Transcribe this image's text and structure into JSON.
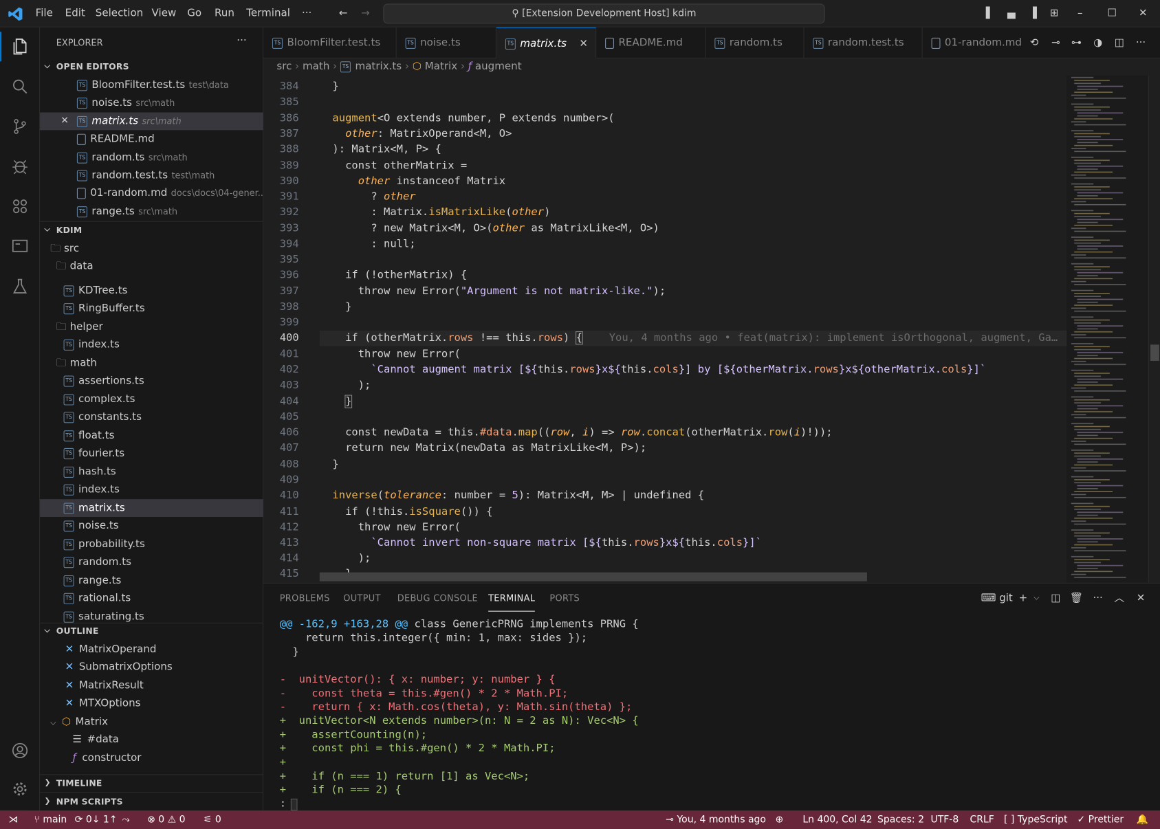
{
  "titlebar": {
    "menus": [
      "File",
      "Edit",
      "Selection",
      "View",
      "Go",
      "Run",
      "Terminal",
      "···"
    ],
    "command_center": "[Extension Development Host] kdim"
  },
  "sidebar": {
    "title": "EXPLORER",
    "open_editors_header": "OPEN EDITORS",
    "open_editors": [
      {
        "name": "BloomFilter.test.ts",
        "path": "test\\data",
        "icon": "ts"
      },
      {
        "name": "noise.ts",
        "path": "src\\math",
        "icon": "ts"
      },
      {
        "name": "matrix.ts",
        "path": "src\\math",
        "icon": "ts"
      },
      {
        "name": "README.md",
        "path": "",
        "icon": "md"
      },
      {
        "name": "random.ts",
        "path": "src\\math",
        "icon": "ts"
      },
      {
        "name": "random.test.ts",
        "path": "test\\math",
        "icon": "ts"
      },
      {
        "name": "01-random.md",
        "path": "docs\\docs\\04-gener...",
        "icon": "md"
      },
      {
        "name": "range.ts",
        "path": "src\\math",
        "icon": "ts"
      }
    ],
    "workspace_header": "KDIM",
    "folders": {
      "src": "src",
      "data": "data",
      "helper": "helper",
      "math": "math"
    },
    "data_files": [
      "KDTree.ts",
      "RingBuffer.ts"
    ],
    "helper_files": [
      "index.ts"
    ],
    "math_files": [
      "assertions.ts",
      "complex.ts",
      "constants.ts",
      "float.ts",
      "fourier.ts",
      "hash.ts",
      "index.ts",
      "matrix.ts",
      "noise.ts",
      "probability.ts",
      "random.ts",
      "range.ts",
      "rational.ts",
      "saturating.ts"
    ],
    "outline_header": "OUTLINE",
    "outline": {
      "types": [
        "MatrixOperand",
        "SubmatrixOptions",
        "MatrixResult",
        "MTXOptions"
      ],
      "class": "Matrix",
      "members": [
        "#data",
        "constructor"
      ]
    },
    "timeline_header": "TIMELINE",
    "npm_header": "NPM SCRIPTS"
  },
  "tabs": [
    "BloomFilter.test.ts",
    "noise.ts",
    "matrix.ts",
    "README.md",
    "random.ts",
    "random.test.ts",
    "01-random.md"
  ],
  "breadcrumb": {
    "src": "src",
    "math": "math",
    "file": "matrix.ts",
    "class": "Matrix",
    "method": "augment"
  },
  "editor": {
    "line_numbers": [
      "384",
      "385",
      "386",
      "387",
      "388",
      "389",
      "390",
      "391",
      "392",
      "393",
      "394",
      "395",
      "396",
      "397",
      "398",
      "399",
      "400",
      "401",
      "402",
      "403",
      "404",
      "405",
      "406",
      "407",
      "408",
      "409",
      "410",
      "411",
      "412",
      "413",
      "414",
      "415"
    ],
    "blame": "You, 4 months ago • feat(matrix): implement isOrthogonal, augment, Ga…",
    "code": {
      "l384_brace": "}",
      "l386_name": "augment",
      "l386_generics": "<O extends number, P extends number>(",
      "l387_param": "other",
      "l387_type": ": MatrixOperand<M, O>",
      "l388": "): Matrix<M, P> {",
      "l389": "const otherMatrix =",
      "l390_param": "other",
      "l390_rest": " instanceof Matrix",
      "l391_q": "? ",
      "l391_param": "other",
      "l392_a": ": Matrix.",
      "l392_fn": "isMatrixLike",
      "l392_param": "other",
      "l393_a": "? new Matrix<M, O>(",
      "l393_param": "other",
      "l393_b": " as MatrixLike<M, O>)",
      "l394": ": null;",
      "l396": "if (!otherMatrix) {",
      "l397_a": "throw new Error(",
      "l397_str": "\"Argument is not matrix-like.\"",
      "l397_b": ");",
      "l398": "}",
      "l400_a": "if (otherMatrix.",
      "l400_p1": "rows",
      "l400_b": " !== this.",
      "l400_p2": "rows",
      "l400_c": ") ",
      "l400_brace": "{",
      "l401": "throw new Error(",
      "l402_a": "`Cannot augment matrix [${",
      "l402_b": "this.",
      "l402_p1": "rows",
      "l402_c": "}x${",
      "l402_d": "this.",
      "l402_p2": "cols",
      "l402_e": "}] by [${otherMatrix.",
      "l402_p3": "rows",
      "l402_f": "}x${otherMatrix.",
      "l402_p4": "cols",
      "l402_g": "}]`",
      "l403": ");",
      "l404_brace": "}",
      "l406_a": "const newData = this.",
      "l406_p": "#data",
      "l406_b": ".",
      "l406_fn1": "map",
      "l406_c": "((",
      "l406_pm1": "row",
      "l406_d": ", ",
      "l406_pm2": "i",
      "l406_e": ") => ",
      "l406_pm3": "row",
      "l406_f": ".",
      "l406_fn2": "concat",
      "l406_g": "(otherMatrix.",
      "l406_fn3": "row",
      "l406_h": "(",
      "l406_pm4": "i",
      "l406_i": ")!));",
      "l407": "return new Matrix(newData as MatrixLike<M, P>);",
      "l408": "}",
      "l410_name": "inverse",
      "l410_a": "(",
      "l410_pm": "tolerance",
      "l410_b": ": number = ",
      "l410_num": "5",
      "l410_c": "): Matrix<M, M> | undefined {",
      "l411_a": "if (!this.",
      "l411_fn": "isSquare",
      "l411_b": "()) {",
      "l412": "throw new Error(",
      "l413_a": "`Cannot invert non-square matrix [${",
      "l413_b": "this.",
      "l413_p1": "rows",
      "l413_c": "}x${",
      "l413_d": "this.",
      "l413_p2": "cols",
      "l413_e": "}]`",
      "l414": ");",
      "l415": "}"
    }
  },
  "panel": {
    "tabs": [
      "PROBLEMS",
      "OUTPUT",
      "DEBUG CONSOLE",
      "TERMINAL",
      "PORTS"
    ],
    "shell_label": "git",
    "terminal_lines": [
      {
        "kind": "hunk",
        "a": "@@ -162,9 +163,28 @@",
        "b": " class GenericPRNG implements PRNG {"
      },
      {
        "kind": "ctx",
        "text": "    return this.integer({ min: 1, max: sides });"
      },
      {
        "kind": "ctx",
        "text": "  }"
      },
      {
        "kind": "ctx",
        "text": ""
      },
      {
        "kind": "del",
        "text": "-  unitVector(): { x: number; y: number } {"
      },
      {
        "kind": "del",
        "text": "-    const theta = this.#gen() * 2 * Math.PI;"
      },
      {
        "kind": "del",
        "text": "-    return { x: Math.cos(theta), y: Math.sin(theta) };"
      },
      {
        "kind": "add",
        "text": "+  unitVector<N extends number>(n: N = 2 as N): Vec<N> {"
      },
      {
        "kind": "add",
        "text": "+    assertCounting(n);"
      },
      {
        "kind": "add",
        "text": "+    const phi = this.#gen() * 2 * Math.PI;"
      },
      {
        "kind": "add",
        "text": "+"
      },
      {
        "kind": "add",
        "text": "+    if (n === 1) return [1] as Vec<N>;"
      },
      {
        "kind": "add",
        "text": "+    if (n === 2) {"
      },
      {
        "kind": "ctx",
        "text": ":"
      }
    ]
  },
  "statusbar": {
    "branch": "main",
    "sync": "0↓ 1↑",
    "errors": "0",
    "warnings": "0",
    "ports": "0",
    "blame": "You, 4 months ago",
    "position": "Ln 400, Col 42",
    "spaces": "Spaces: 2",
    "encoding": "UTF-8",
    "eol": "CRLF",
    "language": "TypeScript",
    "formatter": "Prettier"
  }
}
